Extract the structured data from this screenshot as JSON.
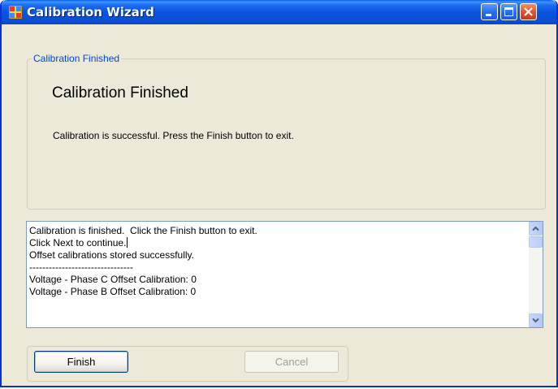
{
  "window": {
    "title": "Calibration Wizard"
  },
  "group": {
    "legend": "Calibration Finished",
    "heading": "Calibration Finished",
    "message": "Calibration is successful.  Press the Finish button to exit."
  },
  "log": {
    "lines": [
      "Calibration is finished.  Click the Finish button to exit.",
      "Click Next to continue.",
      "Offset calibrations stored successfully.",
      "--------------------------------",
      "Voltage - Phase C Offset Calibration: 0",
      "Voltage - Phase B Offset Calibration: 0"
    ]
  },
  "buttons": {
    "finish": "Finish",
    "cancel": "Cancel",
    "cancel_enabled": false
  },
  "icons": {
    "app": "app-icon",
    "minimize": "minimize-icon",
    "maximize": "maximize-icon",
    "close": "close-icon",
    "scroll_up": "scroll-up-arrow-icon",
    "scroll_down": "scroll-down-arrow-icon"
  },
  "colors": {
    "titlebar": "#0855dd",
    "window_bg": "#ece9d8",
    "legend_text": "#0046d5",
    "close_button": "#e2542d"
  }
}
